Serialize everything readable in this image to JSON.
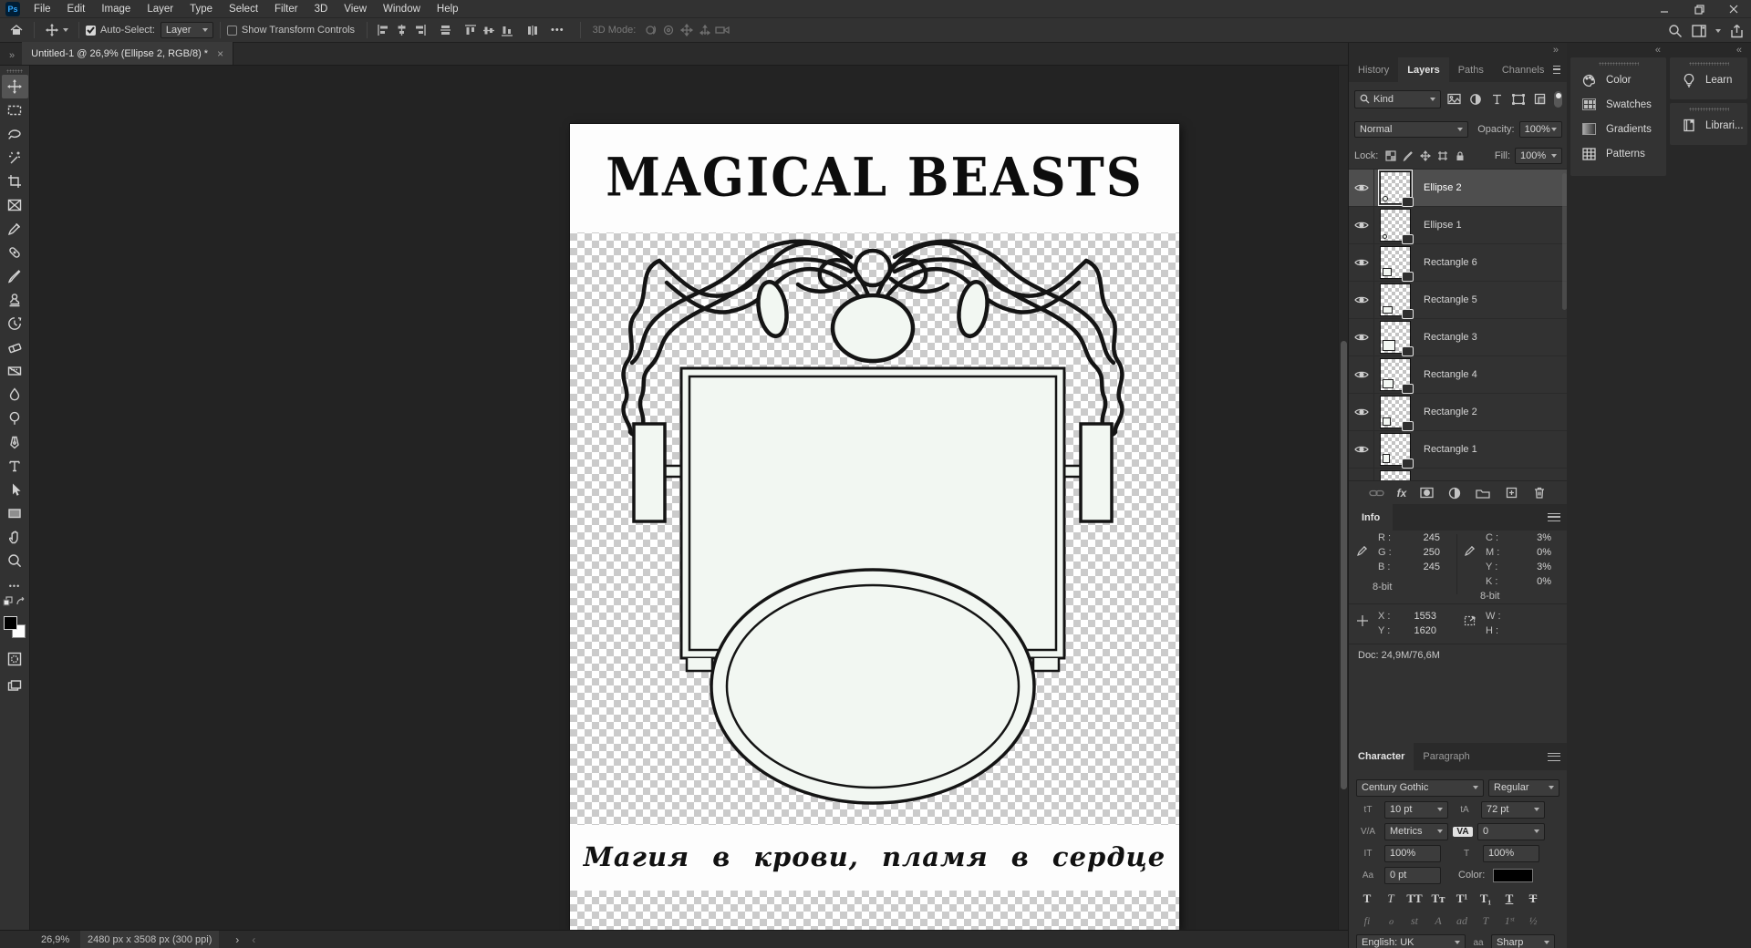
{
  "colors": {
    "app_chrome": "#323232",
    "canvas_bg": "#232323",
    "shape_fill": "#f2f7f2",
    "selected_row": "#4e4e4e",
    "ps_logo_bg": "#001e36",
    "ps_blue": "#31a8ff"
  },
  "icons": {
    "ps_logo": "Ps",
    "collapse_right": "»",
    "collapse_left": "«",
    "close": "×",
    "ellipsis": "•••",
    "fx": "fx",
    "aa": "aa",
    "font_size": "tT",
    "leading": "tA",
    "kerning": "V/A",
    "tracking": "VA",
    "vertical_scale": "IT",
    "horizontal_scale": "T",
    "baseline": "Aa"
  },
  "menu": {
    "items": [
      "File",
      "Edit",
      "Image",
      "Layer",
      "Type",
      "Select",
      "Filter",
      "3D",
      "View",
      "Window",
      "Help"
    ]
  },
  "options_bar": {
    "auto_select": {
      "label": "Auto-Select:",
      "checked": true,
      "target": "Layer"
    },
    "show_transform": {
      "label": "Show Transform Controls",
      "checked": false
    },
    "mode_3d_label": "3D Mode:"
  },
  "doc_tab": {
    "title": "Untitled-1 @ 26,9% (Ellipse 2, RGB/8) *"
  },
  "layers_panel": {
    "tabs": [
      "History",
      "Layers",
      "Paths",
      "Channels"
    ],
    "active_tab": "Layers",
    "filter_label": "Kind",
    "blend_mode": "Normal",
    "opacity_label": "Opacity:",
    "opacity": "100%",
    "lock_label": "Lock:",
    "fill_label": "Fill:",
    "fill": "100%",
    "layers": [
      {
        "name": "Ellipse 2",
        "selected": true
      },
      {
        "name": "Ellipse 1",
        "selected": false
      },
      {
        "name": "Rectangle 6",
        "selected": false
      },
      {
        "name": "Rectangle 5",
        "selected": false
      },
      {
        "name": "Rectangle 3",
        "selected": false
      },
      {
        "name": "Rectangle 4",
        "selected": false
      },
      {
        "name": "Rectangle 2",
        "selected": false
      },
      {
        "name": "Rectangle 1",
        "selected": false
      }
    ]
  },
  "info_panel": {
    "tab": "Info",
    "labels": {
      "r": "R :",
      "g": "G :",
      "b": "B :",
      "c": "C :",
      "m": "M :",
      "y": "Y :",
      "k": "K :",
      "x": "X :",
      "y2": "Y :",
      "w": "W :",
      "h": "H :"
    },
    "values": {
      "r": "245",
      "g": "250",
      "b": "245",
      "c": "3%",
      "m": "0%",
      "y": "3%",
      "k": "0%",
      "x": "1553",
      "y2": "1620",
      "w": "",
      "h": ""
    },
    "bit_left": "8-bit",
    "bit_right": "8-bit",
    "doc": "Doc: 24,9M/76,6M"
  },
  "character_panel": {
    "tabs": [
      "Character",
      "Paragraph"
    ],
    "active_tab": "Character",
    "font_family": "Century Gothic",
    "font_style": "Regular",
    "size": "10 pt",
    "leading": "72 pt",
    "kerning": "Metrics",
    "tracking": "0",
    "vertical_scale": "100%",
    "horizontal_scale": "100%",
    "baseline": "0 pt",
    "color_label": "Color:",
    "styles_row": [
      "T",
      "T",
      "TT",
      "Tᴛ",
      "T¹",
      "T₁",
      "T",
      "T"
    ],
    "opentype_row": [
      "fi",
      "ℴ",
      "st",
      "A",
      "ad",
      "T",
      "1ˢᵗ",
      "½"
    ],
    "language": "English: UK",
    "anti_alias": "Sharp"
  },
  "rail": {
    "group1": [
      "Color",
      "Swatches",
      "Gradients",
      "Patterns"
    ],
    "group2": [
      "Learn",
      "Librari..."
    ]
  },
  "status_bar": {
    "zoom": "26,9%",
    "doc_size": "2480 px x 3508 px (300 ppi)",
    "chev_right": "›",
    "chev_left": "‹"
  },
  "document": {
    "title": "MAGICAL BEASTS",
    "subtitle": "Магия в крови, пламя в сердце"
  }
}
